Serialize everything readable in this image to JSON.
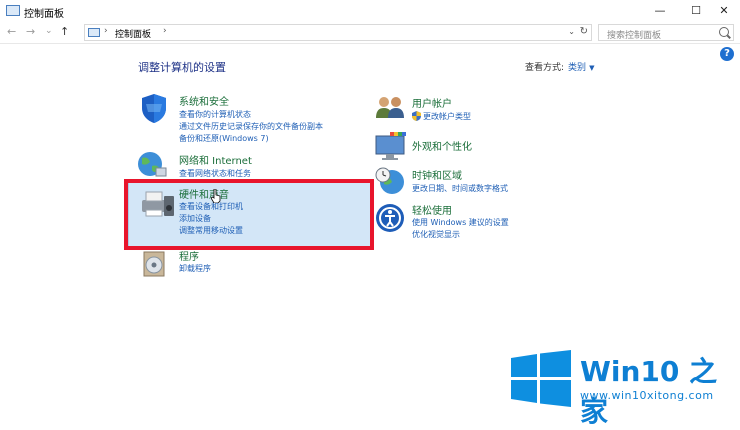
{
  "window": {
    "title": "控制面板",
    "minimize": "—",
    "maximize": "☐",
    "close": "✕"
  },
  "nav": {
    "back": "←",
    "forward": "→",
    "recent": "⌄",
    "up": "↑"
  },
  "address": {
    "root_sep": "›",
    "crumb": "控制面板",
    "crumb_sep": "›",
    "dropdown": "⌄",
    "refresh": "↻"
  },
  "search": {
    "placeholder": "搜索控制面板"
  },
  "help": {
    "label": "?"
  },
  "main": {
    "heading": "调整计算机的设置",
    "view_by": {
      "label": "查看方式:",
      "value": "类别",
      "arrow": "▼"
    }
  },
  "categories_left": [
    {
      "title": "系统和安全",
      "links": [
        "查看你的计算机状态",
        "通过文件历史记录保存你的文件备份副本",
        "备份和还原(Windows 7)"
      ]
    },
    {
      "title": "网络和 Internet",
      "links": [
        "查看网络状态和任务"
      ]
    },
    {
      "title": "硬件和声音",
      "links": [
        "查看设备和打印机",
        "添加设备",
        "调整常用移动设置"
      ]
    },
    {
      "title": "程序",
      "links": [
        "卸载程序"
      ]
    }
  ],
  "categories_right": [
    {
      "title": "用户帐户",
      "links": [
        "更改帐户类型"
      ]
    },
    {
      "title": "外观和个性化",
      "links": []
    },
    {
      "title": "时钟和区域",
      "links": [
        "更改日期、时间或数字格式"
      ]
    },
    {
      "title": "轻松使用",
      "links": [
        "使用 Windows 建议的设置",
        "优化视觉显示"
      ]
    }
  ],
  "watermark": {
    "text": "Win10 之家",
    "url": "www.win10xitong.com"
  },
  "colors": {
    "accent": "#1f5fb5",
    "category_title": "#1b6e3a",
    "highlight": "#d3e6f7",
    "annotation_red": "#e8152c",
    "logo_blue": "#0e7fd3"
  }
}
